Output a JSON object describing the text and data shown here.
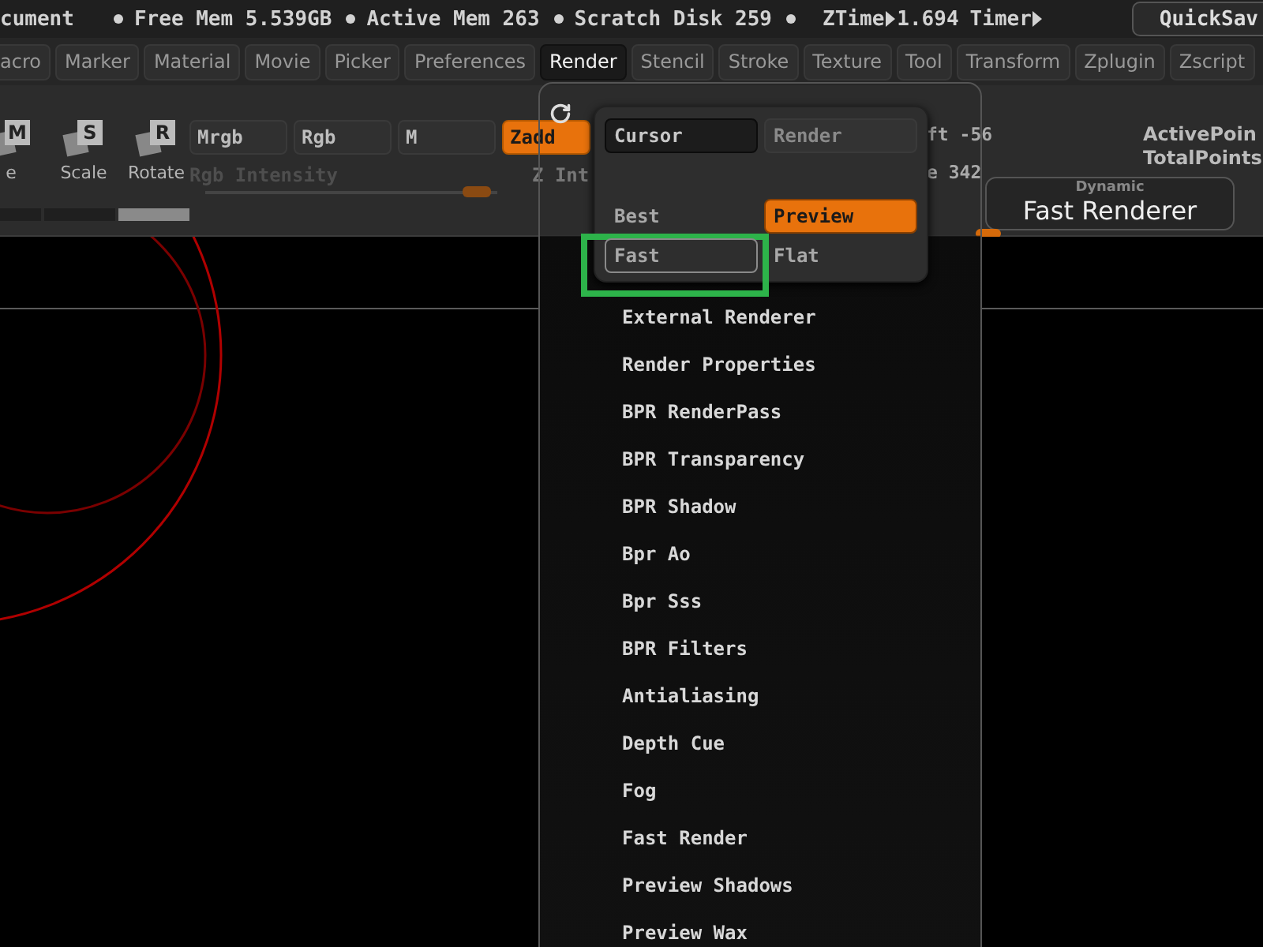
{
  "status_bar": {
    "document": "cument",
    "stats": [
      "Free Mem 5.539GB",
      "Active Mem 263",
      "Scratch Disk 259"
    ],
    "ztime_label": "ZTime",
    "ztime_value": "1.694",
    "timer_label": "Timer",
    "quicksave": "QuickSav"
  },
  "menu": [
    {
      "label": "acro",
      "selected": false
    },
    {
      "label": "Marker",
      "selected": false
    },
    {
      "label": "Material",
      "selected": false
    },
    {
      "label": "Movie",
      "selected": false
    },
    {
      "label": "Picker",
      "selected": false
    },
    {
      "label": "Preferences",
      "selected": false
    },
    {
      "label": "Render",
      "selected": true
    },
    {
      "label": "Stencil",
      "selected": false
    },
    {
      "label": "Stroke",
      "selected": false
    },
    {
      "label": "Texture",
      "selected": false
    },
    {
      "label": "Tool",
      "selected": false
    },
    {
      "label": "Transform",
      "selected": false
    },
    {
      "label": "Zplugin",
      "selected": false
    },
    {
      "label": "Zscript",
      "selected": false
    }
  ],
  "toolbar": {
    "tools": [
      {
        "letter": "M",
        "label": "e"
      },
      {
        "letter": "S",
        "label": "Scale"
      },
      {
        "letter": "R",
        "label": "Rotate"
      }
    ],
    "modes": [
      {
        "label": "Mrgb",
        "selected": false
      },
      {
        "label": "Rgb",
        "selected": false
      },
      {
        "label": "M",
        "selected": false
      },
      {
        "label": "Zadd",
        "selected": true
      }
    ],
    "rgb_intensity": {
      "label": "Rgb Intensity",
      "disabled": true,
      "level": 0.93
    },
    "z_intensity_label": "Z Int",
    "hidden_values": [
      "ft -56",
      "e 342"
    ],
    "active_points": "ActivePoin",
    "total_points": "TotalPoints",
    "renderer_button": {
      "caption": "Dynamic",
      "label": "Fast Renderer"
    }
  },
  "render_palette": {
    "popup": {
      "top_buttons": [
        {
          "label": "Cursor",
          "disabled": false
        },
        {
          "label": "Render",
          "disabled": true
        }
      ],
      "quality": [
        {
          "label": "Best",
          "selected": false,
          "hovered": false
        },
        {
          "label": "Preview",
          "selected": true,
          "hovered": false
        },
        {
          "label": "Fast",
          "selected": false,
          "hovered": true
        },
        {
          "label": "Flat",
          "selected": false,
          "hovered": false
        }
      ]
    },
    "items": [
      "External Renderer",
      "Render Properties",
      "BPR RenderPass",
      "BPR Transparency",
      "BPR Shadow",
      "Bpr Ao",
      "Bpr Sss",
      "BPR Filters",
      "Antialiasing",
      "Depth Cue",
      "Fog",
      "Fast Render",
      "Preview Shadows",
      "Preview Wax"
    ]
  }
}
